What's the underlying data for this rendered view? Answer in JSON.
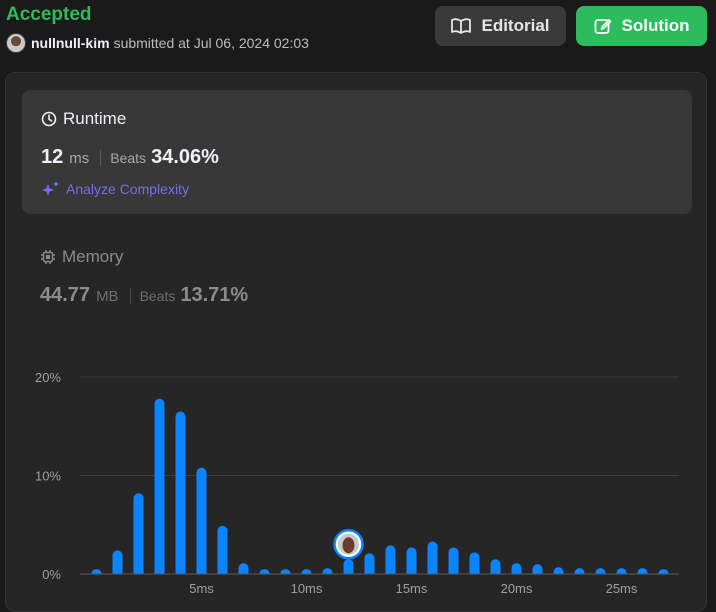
{
  "header": {
    "status": "Accepted",
    "username": "nullnull-kim",
    "submitted_text": "submitted at Jul 06, 2024 02:03",
    "editorial_label": "Editorial",
    "solution_label": "Solution"
  },
  "runtime": {
    "title": "Runtime",
    "value": "12",
    "unit": "ms",
    "beats_label": "Beats",
    "beats_value": "34.06%",
    "analyze_label": "Analyze Complexity"
  },
  "memory": {
    "title": "Memory",
    "value": "44.77",
    "unit": "MB",
    "beats_label": "Beats",
    "beats_value": "13.71%"
  },
  "colors": {
    "accepted": "#2cbb5d",
    "bar": "#0a84ff",
    "analyze": "#7a6cf0"
  },
  "chart_data": {
    "type": "bar",
    "x": [
      0,
      1,
      2,
      3,
      4,
      5,
      6,
      7,
      8,
      9,
      10,
      11,
      12,
      13,
      14,
      15,
      16,
      17,
      18,
      19,
      20,
      21,
      22,
      23,
      24,
      25,
      26,
      27
    ],
    "values": [
      0.5,
      2.4,
      8.2,
      17.8,
      16.5,
      10.8,
      4.9,
      1.1,
      0.5,
      0.5,
      0.5,
      0.6,
      1.5,
      2.1,
      2.9,
      2.7,
      3.3,
      2.7,
      2.2,
      1.5,
      1.1,
      1.0,
      0.7,
      0.6,
      0.6,
      0.6,
      0.6,
      0.5
    ],
    "x_tick_labels": [
      "5ms",
      "10ms",
      "15ms",
      "20ms",
      "25ms"
    ],
    "x_tick_values": [
      5,
      10,
      15,
      20,
      25
    ],
    "y_tick_labels": [
      "0%",
      "10%",
      "20%"
    ],
    "y_tick_values": [
      0,
      10,
      20
    ],
    "ylim": [
      0,
      20
    ],
    "marker_x": 12,
    "grid": true
  }
}
